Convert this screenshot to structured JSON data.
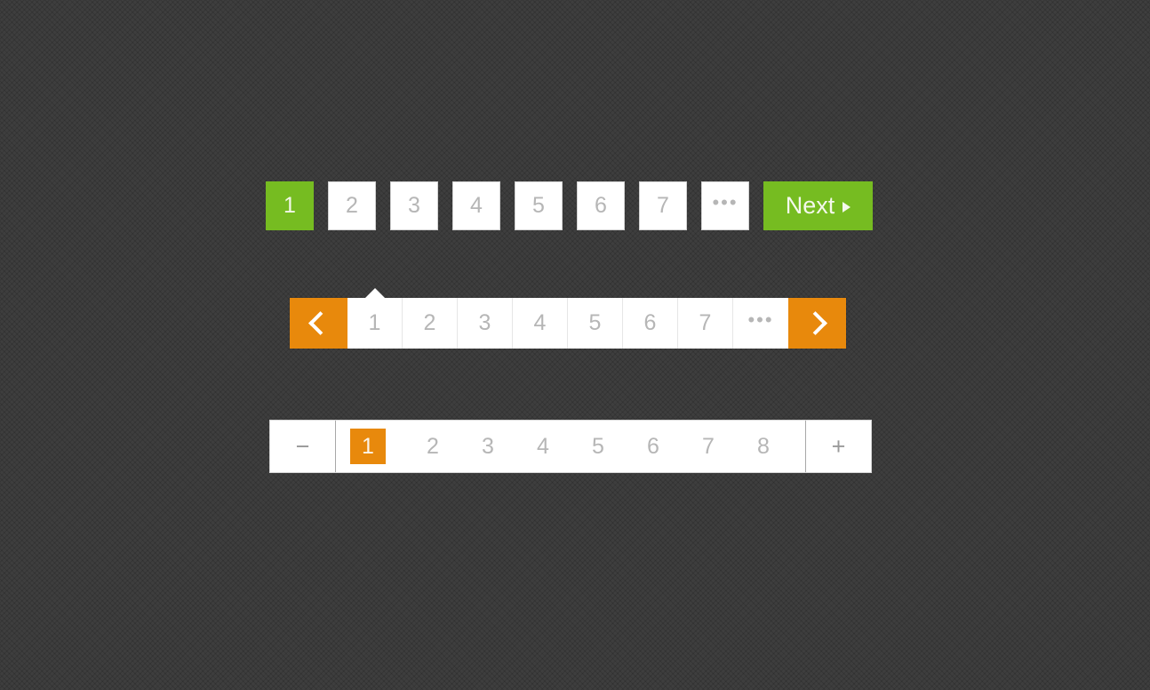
{
  "theme": {
    "background": "#3a3a3a",
    "accent_green": "#76bc21",
    "accent_orange": "#e8890c",
    "number_color": "#b6b6b6",
    "surface": "#ffffff"
  },
  "paginations": [
    {
      "name": "boxed-green-pagination",
      "style": "boxed",
      "accent": "#76bc21",
      "active_page": "1",
      "pages": [
        "1",
        "2",
        "3",
        "4",
        "5",
        "6",
        "7"
      ],
      "ellipsis": "•••",
      "next_label": "Next",
      "next_icon": "caret-right-icon"
    },
    {
      "name": "joined-orange-pagination",
      "style": "joined-bar",
      "accent": "#e8890c",
      "active_page": "1",
      "prev_icon": "chevron-left-icon",
      "next_icon": "chevron-right-icon",
      "pages": [
        "1",
        "2",
        "3",
        "4",
        "5",
        "6",
        "7"
      ],
      "ellipsis": "•••"
    },
    {
      "name": "stepper-orange-pagination",
      "style": "stepper-bar",
      "accent": "#e8890c",
      "active_page": "1",
      "minus_label": "−",
      "plus_label": "+",
      "pages": [
        "1",
        "2",
        "3",
        "4",
        "5",
        "6",
        "7",
        "8"
      ]
    }
  ]
}
